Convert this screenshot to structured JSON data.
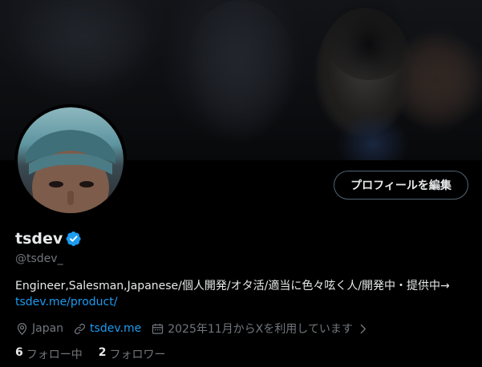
{
  "profile": {
    "edit_button": "プロフィールを編集",
    "display_name": "tsdev",
    "handle": "@tsdev_",
    "bio_text": "Engineer,Salesman,Japanese/個人開発/オタ活/適当に色々呟く人/開発中・提供中→",
    "bio_link": "tsdev.me/product/",
    "location": "Japan",
    "website": "tsdev.me",
    "joined": "2025年11月からXを利用しています",
    "following_count": "6",
    "following_label": "フォロー中",
    "followers_count": "2",
    "followers_label": "フォロワー"
  },
  "icons": {
    "verified": "verified-badge-icon",
    "location": "location-pin-icon",
    "website": "link-icon",
    "joined": "calendar-icon",
    "chevron": "chevron-right-icon"
  },
  "colors": {
    "accent": "#1d9bf0",
    "background": "#000000",
    "text_primary": "#e7e9ea",
    "text_secondary": "#71767b"
  }
}
